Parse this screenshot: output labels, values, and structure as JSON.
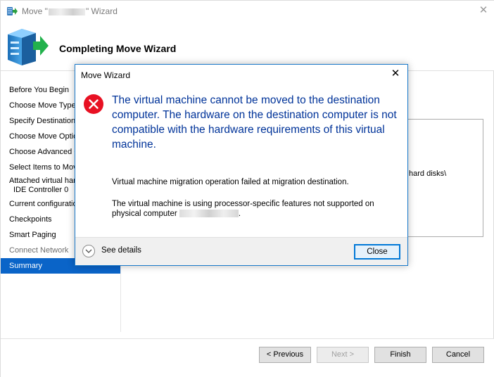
{
  "window": {
    "title_prefix": "Move \"",
    "title_suffix": "\" Wizard",
    "close_glyph": "✕"
  },
  "header": {
    "title": "Completing Move Wizard",
    "icon": "server-arrow-icon"
  },
  "sidebar": {
    "steps": [
      {
        "label": "Before You Begin"
      },
      {
        "label": "Choose Move Type"
      },
      {
        "label": "Specify Destination"
      },
      {
        "label": "Choose Move Options"
      },
      {
        "label": "Choose Advanced Options"
      },
      {
        "label": "Select Items to Move"
      },
      {
        "label": "Attached virtual hard disk",
        "label2": "IDE Controller 0"
      },
      {
        "label": "Current configuration"
      },
      {
        "label": "Checkpoints"
      },
      {
        "label": "Smart Paging"
      },
      {
        "label": "Connect Network"
      },
      {
        "label": "Summary"
      }
    ]
  },
  "panel": {
    "visible_text": "hard disks\\"
  },
  "footer": {
    "previous_label": "< Previous",
    "next_label": "Next >",
    "finish_label": "Finish",
    "cancel_label": "Cancel"
  },
  "dialog": {
    "title": "Move Wizard",
    "close_glyph": "✕",
    "main_message": "The virtual machine cannot be moved to the destination computer. The hardware on the destination computer is not compatible with the hardware requirements of this virtual machine.",
    "detail1": "Virtual machine migration operation failed at migration destination.",
    "detail2_prefix": "The virtual machine is using processor-specific features not supported on physical computer",
    "detail2_suffix": ".",
    "see_details_label": "See details",
    "close_label": "Close"
  },
  "colors": {
    "accent": "#0078d7",
    "error_red": "#e81123",
    "message_blue": "#003399",
    "selected_step": "#0a64c8"
  }
}
